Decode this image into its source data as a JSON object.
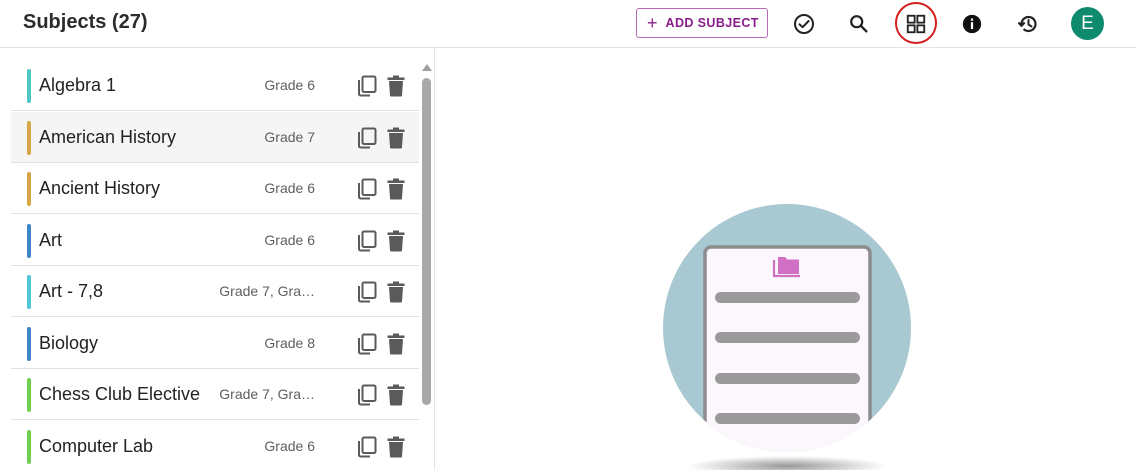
{
  "header": {
    "title": "Subjects (27)",
    "add_button": {
      "icon": "plus-icon",
      "label": "ADD SUBJECT"
    },
    "icons": [
      "check-circle-icon",
      "search-icon",
      "grid-view-icon",
      "info-icon",
      "history-icon"
    ],
    "avatar_letter": "E"
  },
  "colors": {
    "accent": "#8a1c8a",
    "avatar": "#0e8a6e",
    "highlight_ring": "#d32020",
    "illustration_circle": "#a8c9d2",
    "folder_icon": "#d070c4"
  },
  "subjects": [
    {
      "name": "Algebra 1",
      "grade": "Grade 6",
      "color": "#4fc7c0"
    },
    {
      "name": "American History",
      "grade": "Grade 7",
      "color": "#d4a646",
      "selected": true
    },
    {
      "name": "Ancient History",
      "grade": "Grade 6",
      "color": "#d4a646"
    },
    {
      "name": "Art",
      "grade": "Grade 6",
      "color": "#3f86c7"
    },
    {
      "name": "Art - 7,8",
      "grade": "Grade 7, Gra…",
      "color": "#4fc7d7"
    },
    {
      "name": "Biology",
      "grade": "Grade 8",
      "color": "#3f86c7"
    },
    {
      "name": "Chess Club Elective",
      "grade": "Grade 7, Gra…",
      "color": "#6fd04f"
    },
    {
      "name": "Computer Lab",
      "grade": "Grade 6",
      "color": "#6fd04f"
    }
  ],
  "row_actions": {
    "copy_icon": "copy-icon",
    "delete_icon": "trash-icon"
  },
  "illustration": {
    "folder_icon": "folder-stack-icon"
  }
}
